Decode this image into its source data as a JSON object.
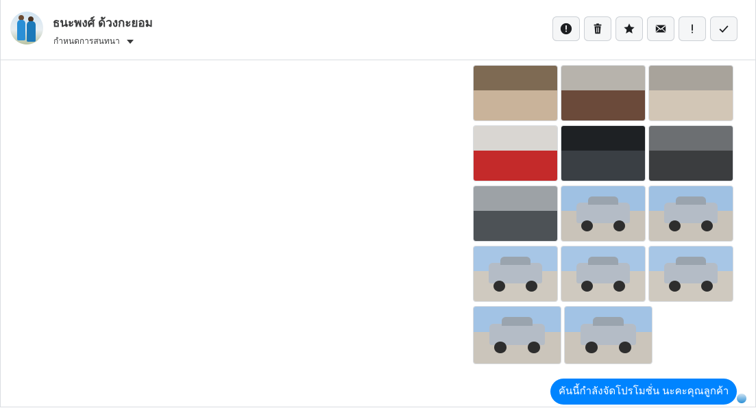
{
  "header": {
    "contact_name": "ธนะพงศ์ ด้วงกะยอม",
    "conversation_label": "กำหนดการสนทนา",
    "actions": [
      {
        "name": "report-button",
        "icon": "alert-circle-icon",
        "glyph": "!"
      },
      {
        "name": "delete-button",
        "icon": "trash-icon",
        "glyph": ""
      },
      {
        "name": "star-button",
        "icon": "star-icon",
        "glyph": "★"
      },
      {
        "name": "mail-button",
        "icon": "envelope-icon",
        "glyph": ""
      },
      {
        "name": "important-button",
        "icon": "exclamation-icon",
        "glyph": "!"
      },
      {
        "name": "done-button",
        "icon": "check-icon",
        "glyph": "✓"
      }
    ]
  },
  "photos": {
    "grid3": [
      {
        "desc": "door-interior",
        "sky": "#7e6a53",
        "ground": "#c9b39a"
      },
      {
        "desc": "dashboard-steering",
        "sky": "#b7b3ac",
        "ground": "#6b4a3a"
      },
      {
        "desc": "front-seats",
        "sky": "#a8a39b",
        "ground": "#d2c6b6"
      },
      {
        "desc": "red-black-seat",
        "sky": "#d9d6d2",
        "ground": "#c42a2a"
      },
      {
        "desc": "gauge-cluster",
        "sky": "#1e2124",
        "ground": "#3a3f44"
      },
      {
        "desc": "wheel",
        "sky": "#6c6f72",
        "ground": "#3b3d3f"
      },
      {
        "desc": "engine-bay",
        "sky": "#9da2a6",
        "ground": "#4d5256"
      },
      {
        "desc": "truck-front-angle",
        "sky": "#9fc1e3",
        "ground": "#c9c3b9"
      },
      {
        "desc": "truck-rear",
        "sky": "#9fc1e3",
        "ground": "#c9c3b9"
      },
      {
        "desc": "truck-side",
        "sky": "#a7c6e6",
        "ground": "#cfc9bf"
      },
      {
        "desc": "truck-rear-angle",
        "sky": "#a7c6e6",
        "ground": "#cfc9bf"
      },
      {
        "desc": "truck-rear-quarter",
        "sky": "#a7c6e6",
        "ground": "#cfc9bf"
      }
    ],
    "grid2": [
      {
        "desc": "truck-front",
        "sky": "#a2c3e5",
        "ground": "#cbc5bb"
      },
      {
        "desc": "truck-front-quarter",
        "sky": "#a2c3e5",
        "ground": "#cbc5bb"
      }
    ]
  },
  "message": {
    "text": "คันนี้กำลังจัดโปรโมชั่น นะคะคุณลูกค้า"
  },
  "colors": {
    "accent": "#0084ff",
    "border": "#dadde1"
  }
}
